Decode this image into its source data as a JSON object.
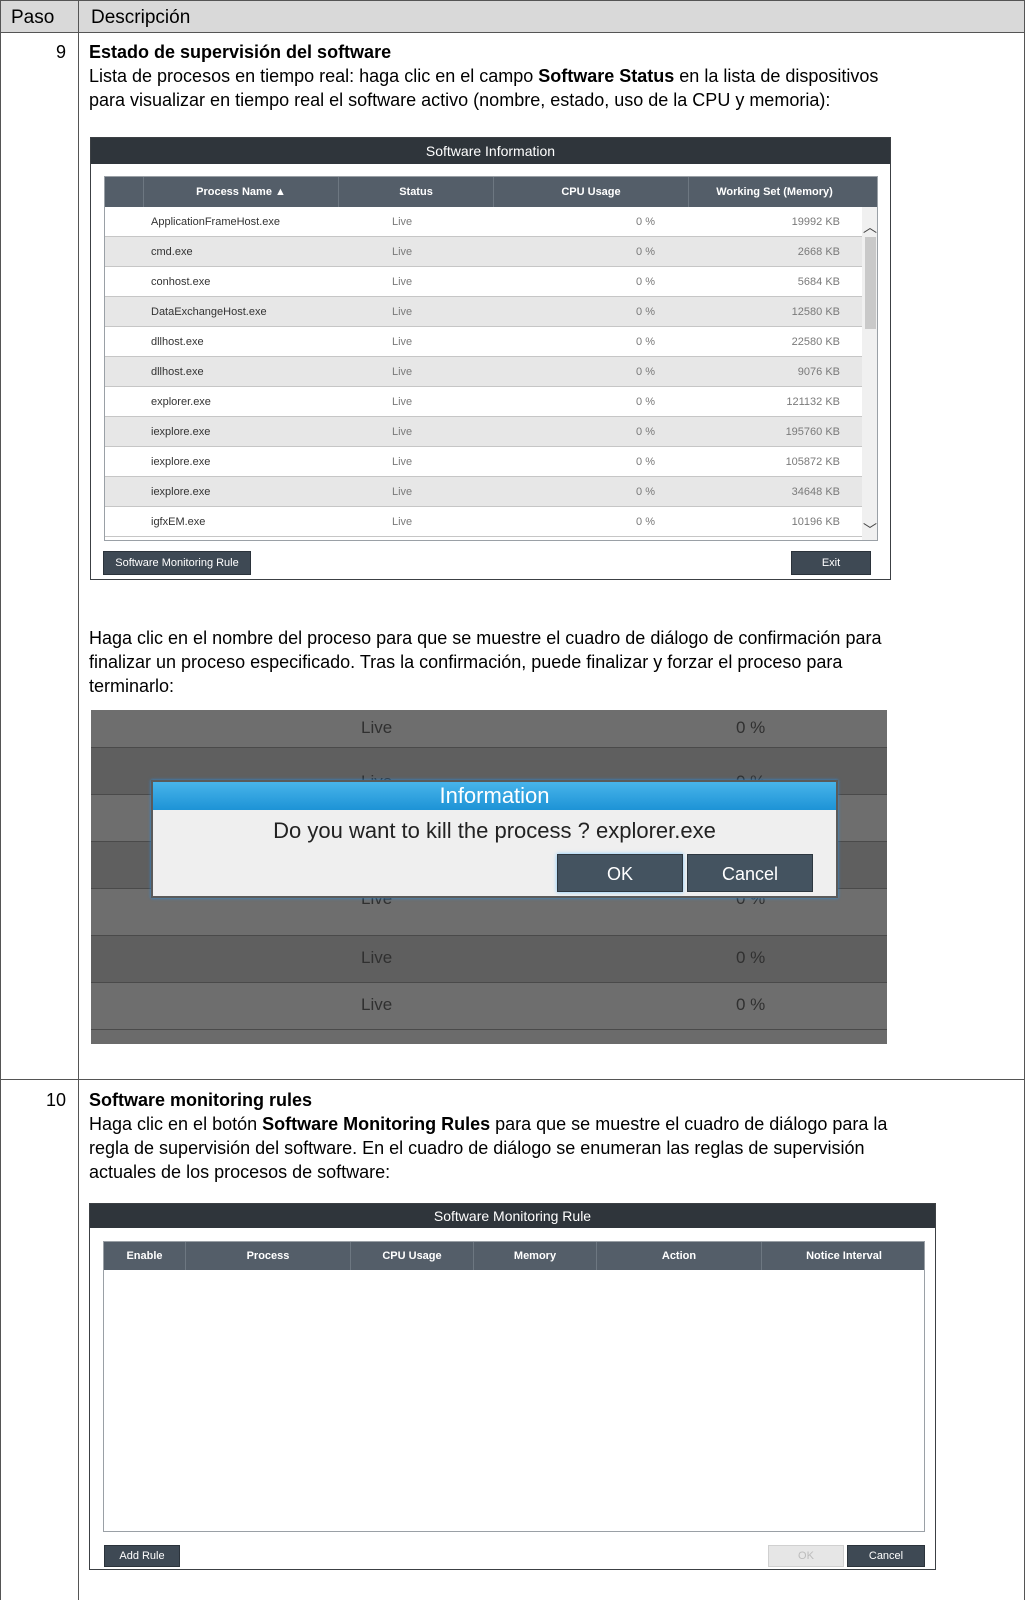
{
  "table_header": {
    "paso": "Paso",
    "descripcion": "Descripción"
  },
  "step9": {
    "number": "9",
    "title": "Estado de supervisión del software",
    "intro_before": "Lista de procesos en tiempo real: haga clic en el campo ",
    "intro_bold": "Software Status",
    "intro_after_line1": " en la lista de dispositivos",
    "intro_line2": "para visualizar en tiempo real el software activo (nombre, estado, uso de la CPU y memoria):",
    "kill_text_line1": "Haga clic en el nombre del proceso para que se muestre el cuadro de diálogo de confirmación para",
    "kill_text_line2": "finalizar un proceso especificado. Tras la confirmación, puede finalizar y forzar el proceso para",
    "kill_text_line3": "terminarlo:"
  },
  "software_info": {
    "title": "Software Information",
    "columns": [
      "Process Name ▲",
      "Status",
      "CPU Usage",
      "Working Set (Memory)"
    ],
    "rows": [
      {
        "name": "ApplicationFrameHost.exe",
        "status": "Live",
        "cpu": "0 %",
        "mem": "19992 KB"
      },
      {
        "name": "cmd.exe",
        "status": "Live",
        "cpu": "0 %",
        "mem": "2668 KB"
      },
      {
        "name": "conhost.exe",
        "status": "Live",
        "cpu": "0 %",
        "mem": "5684 KB"
      },
      {
        "name": "DataExchangeHost.exe",
        "status": "Live",
        "cpu": "0 %",
        "mem": "12580 KB"
      },
      {
        "name": "dllhost.exe",
        "status": "Live",
        "cpu": "0 %",
        "mem": "22580 KB"
      },
      {
        "name": "dllhost.exe",
        "status": "Live",
        "cpu": "0 %",
        "mem": "9076 KB"
      },
      {
        "name": "explorer.exe",
        "status": "Live",
        "cpu": "0 %",
        "mem": "121132 KB"
      },
      {
        "name": "iexplore.exe",
        "status": "Live",
        "cpu": "0 %",
        "mem": "195760 KB"
      },
      {
        "name": "iexplore.exe",
        "status": "Live",
        "cpu": "0 %",
        "mem": "105872 KB"
      },
      {
        "name": "iexplore.exe",
        "status": "Live",
        "cpu": "0 %",
        "mem": "34648 KB"
      },
      {
        "name": "igfxEM.exe",
        "status": "Live",
        "cpu": "0 %",
        "mem": "10196 KB"
      }
    ],
    "btn_rule": "Software Monitoring Rule",
    "btn_exit": "Exit"
  },
  "kill_dialog": {
    "bg_rows": [
      {
        "status": "Live",
        "cpu": "0 %"
      },
      {
        "status": "Live",
        "cpu": "0 %"
      },
      {
        "status": "Live",
        "cpu": "0 %"
      },
      {
        "status": "Live",
        "cpu": "0 %"
      },
      {
        "status": "Live",
        "cpu": "0 %"
      }
    ],
    "title": "Information",
    "message": "Do you want to kill the process ? explorer.exe",
    "ok": "OK",
    "cancel": "Cancel"
  },
  "step10": {
    "number": "10",
    "title": "Software monitoring rules",
    "line1_before": "Haga clic en el botón ",
    "line1_bold": "Software Monitoring Rules",
    "line1_after": " para que se muestre el cuadro de diálogo para la",
    "line2": "regla de supervisión del software. En el cuadro de diálogo se enumeran las reglas de supervisión",
    "line3": "actuales de los procesos de software:"
  },
  "monitoring_rule": {
    "title": "Software Monitoring Rule",
    "columns": [
      "Enable",
      "Process",
      "CPU Usage",
      "Memory",
      "Action",
      "Notice Interval"
    ],
    "btn_add": "Add Rule",
    "btn_ok": "OK",
    "btn_cancel": "Cancel"
  }
}
